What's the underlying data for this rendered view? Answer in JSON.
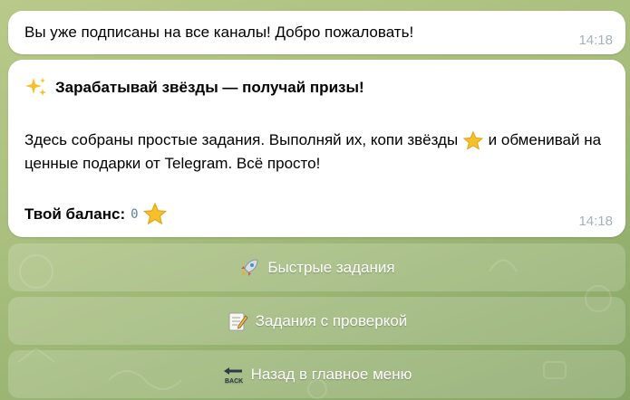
{
  "messages": [
    {
      "text": "Вы уже подписаны на все каналы! Добро пожаловать!",
      "time": "14:18"
    },
    {
      "title_icon": "sparkles-icon",
      "title": "Зарабатывай звёзды — получай призы!",
      "paragraph_part1": "Здесь собраны простые задания. Выполняй их, копи звёзды",
      "paragraph_part2": "и обменивай на ценные подарки от Telegram. Всё просто!",
      "balance_label": "Твой баланс:",
      "balance_value": "0",
      "time": "14:18"
    }
  ],
  "keyboard": {
    "buttons": [
      {
        "label": "Быстрые задания",
        "icon": "rocket-icon"
      },
      {
        "label": "Задания с проверкой",
        "icon": "memo-icon"
      },
      {
        "label": "Назад в главное меню",
        "icon": "back-arrow-icon"
      }
    ]
  },
  "colors": {
    "bubble": "#ffffff",
    "time": "#a5b2b9",
    "balance_value": "#5b7fa6",
    "star": "#f6c02b"
  }
}
